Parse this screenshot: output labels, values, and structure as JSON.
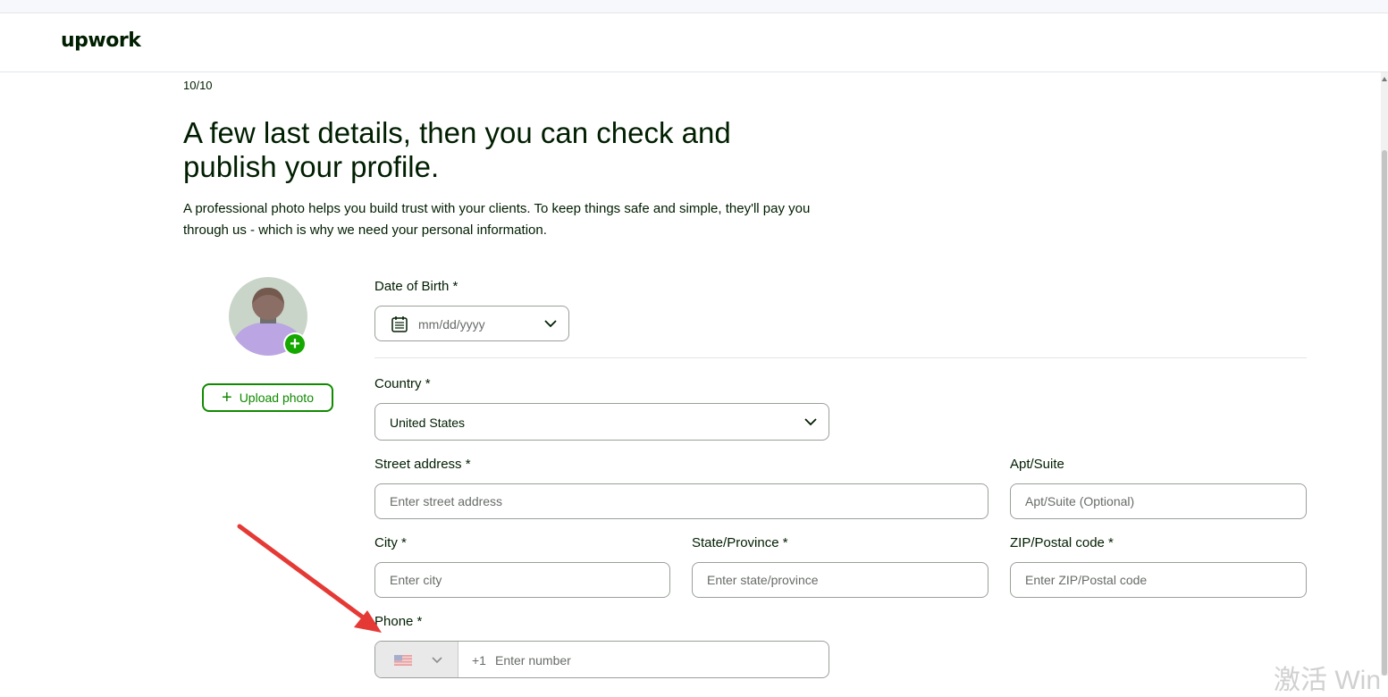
{
  "header": {
    "logo": "upwork"
  },
  "page": {
    "step": "10/10",
    "title": "A few last details, then you can check and publish your profile.",
    "description": "A professional photo helps you build trust with your clients. To keep things safe and simple, they'll pay you through us - which is why we need your personal information."
  },
  "photo": {
    "upload_label": "Upload photo"
  },
  "form": {
    "dob": {
      "label": "Date of Birth *",
      "placeholder": "mm/dd/yyyy"
    },
    "country": {
      "label": "Country *",
      "value": "United States"
    },
    "street": {
      "label": "Street address *",
      "placeholder": "Enter street address"
    },
    "apt": {
      "label": "Apt/Suite",
      "placeholder": "Apt/Suite (Optional)"
    },
    "city": {
      "label": "City *",
      "placeholder": "Enter city"
    },
    "state": {
      "label": "State/Province *",
      "placeholder": "Enter state/province"
    },
    "zip": {
      "label": "ZIP/Postal code *",
      "placeholder": "Enter ZIP/Postal code"
    },
    "phone": {
      "label": "Phone *",
      "dial_code": "+1",
      "placeholder": "Enter number",
      "flag_icon": "us-flag-icon"
    }
  },
  "colors": {
    "brand_green": "#14a800",
    "button_green": "#108a00",
    "annotation_arrow": "#e53935"
  },
  "overlay": {
    "watermark": "激活 Win"
  }
}
